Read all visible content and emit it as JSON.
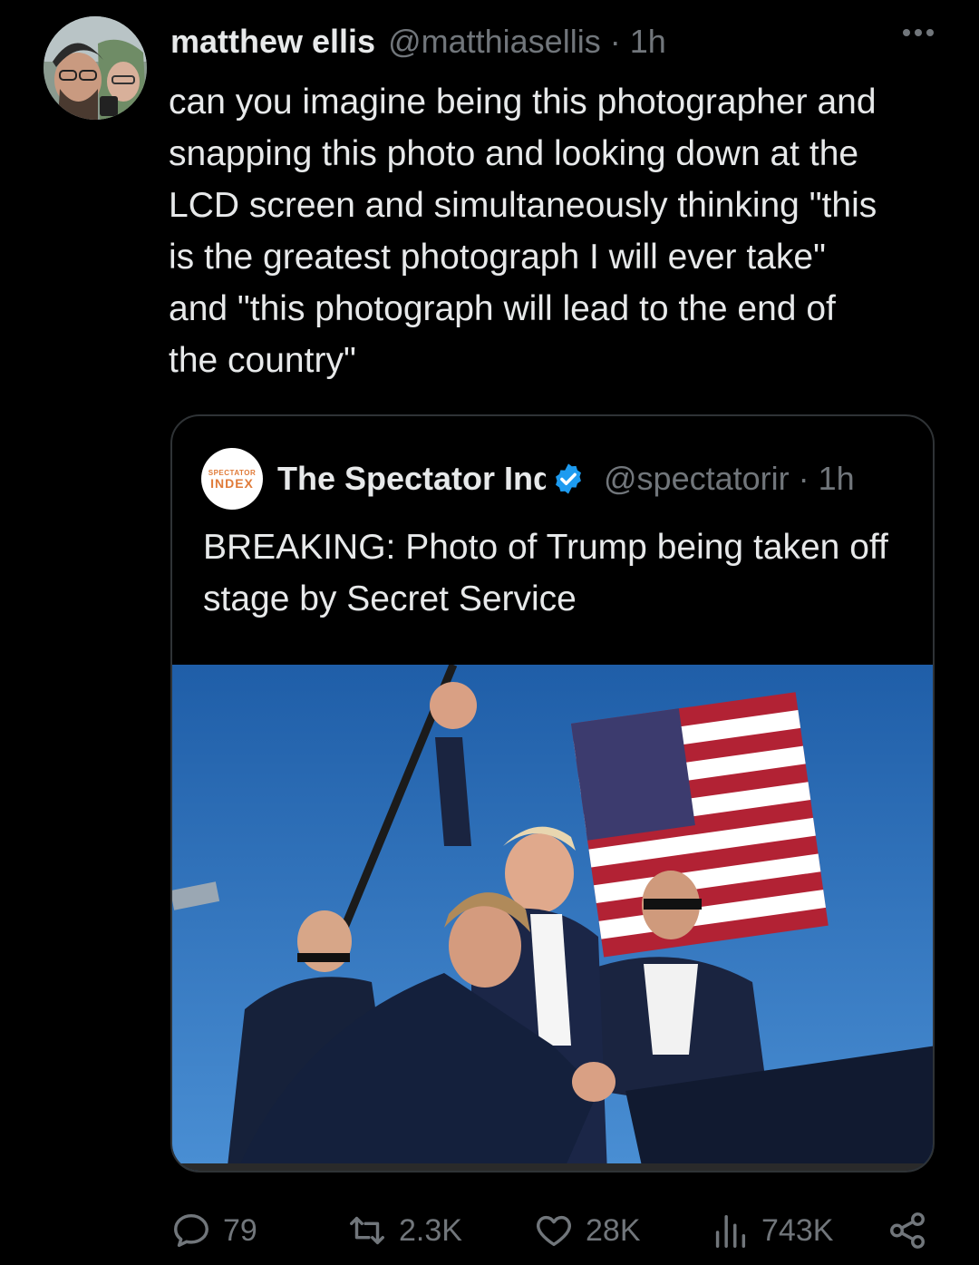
{
  "tweet": {
    "display_name": "matthew ellis",
    "handle": "@matthiasellis",
    "separator": "·",
    "time": "1h",
    "text": "can you imagine being this photographer and\nsnapping this photo and looking down at the\nLCD screen and simultaneously thinking \"this\nis the greatest photograph I will ever take\"\nand \"this photograph will lead to the end of\nthe country\"",
    "more_icon": "more-horizontal-icon"
  },
  "quote": {
    "avatar_top_text": "SPECTATOR",
    "avatar_bottom_text": "INDEX",
    "display_name": "The Spectator Index",
    "verified_icon": "verified-badge-icon",
    "verified_color": "#1d9bf0",
    "handle": "@spectatorir",
    "separator": "·",
    "time": "1h",
    "text": "BREAKING: Photo of Trump being taken off stage by Secret Service"
  },
  "actions": {
    "reply": {
      "icon": "reply-icon",
      "count": "79"
    },
    "retweet": {
      "icon": "retweet-icon",
      "count": "2.3K"
    },
    "like": {
      "icon": "heart-icon",
      "count": "28K"
    },
    "views": {
      "icon": "views-chart-icon",
      "count": "743K"
    },
    "share": {
      "icon": "share-icon"
    }
  },
  "colors": {
    "background": "#000000",
    "text": "#e7e9ea",
    "secondary": "#71767b",
    "border": "#2f3336"
  }
}
